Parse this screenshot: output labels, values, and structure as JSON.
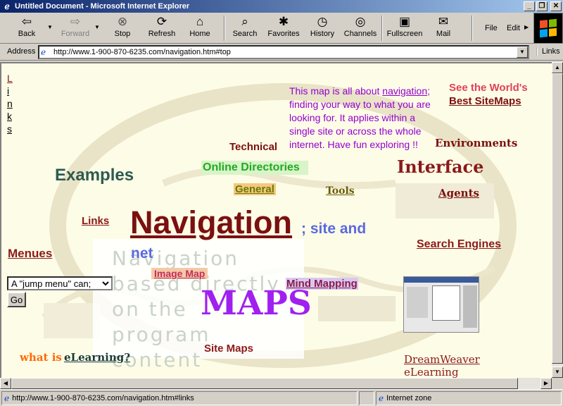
{
  "window": {
    "title": "Untitled Document - Microsoft Internet Explorer"
  },
  "toolbar": {
    "back": "Back",
    "forward": "Forward",
    "stop": "Stop",
    "refresh": "Refresh",
    "home": "Home",
    "search": "Search",
    "favorites": "Favorites",
    "history": "History",
    "channels": "Channels",
    "fullscreen": "Fullscreen",
    "mail": "Mail",
    "file": "File",
    "edit": "Edit"
  },
  "address": {
    "label": "Address",
    "url": "http://www.1-900-870-6235.com/navigation.htm#top",
    "links": "Links"
  },
  "page": {
    "links": "Links",
    "intro_before": "This map is all about ",
    "intro_link": "navigation",
    "intro_after": "; finding your way to what you are looking for. It applies within a single site or across the whole internet. Have fun exploring !!",
    "see_worlds": "See the World's",
    "best_sitemaps": "Best SiteMaps",
    "technical": "Technical",
    "environments": "Environments",
    "online_directories": "Online Directories",
    "examples": "Examples",
    "interface": "Interface",
    "general": "General",
    "tools": "Tools",
    "agents": "Agents",
    "navigation": "Navigation",
    "site_and": "; site and",
    "net": "net",
    "search_engines": "Search Engines",
    "menues": "Menues",
    "image_map": "Image Map",
    "mind_mapping": "Mind Mapping",
    "maps": "MAPS",
    "ghost_text": "Navigation\nbased directly\non the\nprogram\ncontent",
    "jump_menu": "A \"jump menu\" can;",
    "go": "Go",
    "site_maps": "Site Maps",
    "what_is": "what is ",
    "elearning": "eLearning?",
    "dreamweaver": "DreamWeaver",
    "dreamweaver_elearning": "eLearning"
  },
  "status": {
    "url": "http://www.1-900-870-6235.com/navigation.htm#links",
    "zone": "Internet zone"
  }
}
